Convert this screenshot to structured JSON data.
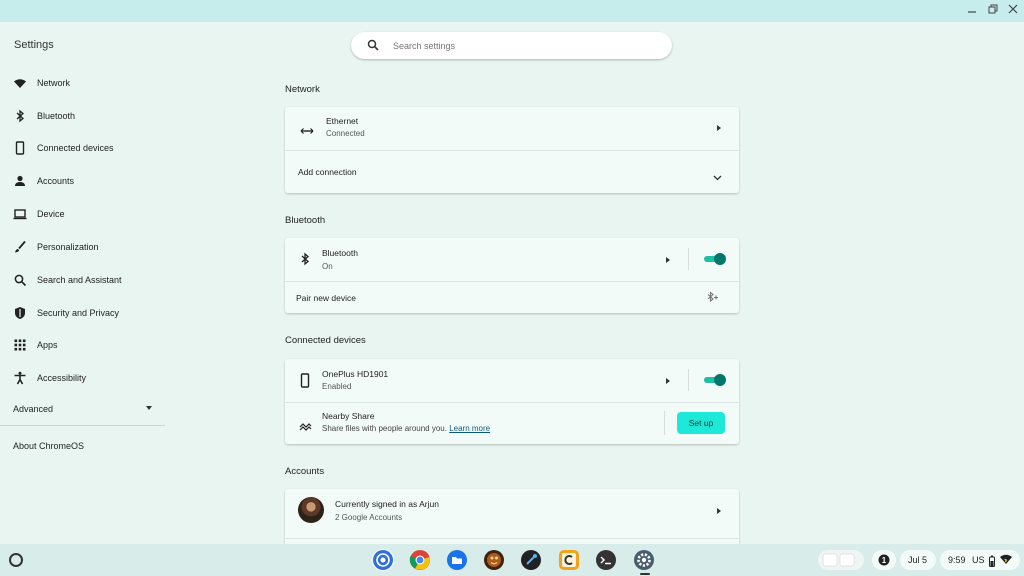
{
  "window": {
    "minimize_icon": "minimize-icon",
    "restore_icon": "restore-icon",
    "close_icon": "close-icon"
  },
  "app": {
    "title": "Settings"
  },
  "search": {
    "placeholder": "Search settings",
    "icon": "search-icon"
  },
  "sidebar": {
    "items": [
      {
        "label": "Network",
        "icon": "wifi-icon"
      },
      {
        "label": "Bluetooth",
        "icon": "bluetooth-icon"
      },
      {
        "label": "Connected devices",
        "icon": "phone-icon"
      },
      {
        "label": "Accounts",
        "icon": "person-icon"
      },
      {
        "label": "Device",
        "icon": "laptop-icon"
      },
      {
        "label": "Personalization",
        "icon": "brush-icon"
      },
      {
        "label": "Search and Assistant",
        "icon": "search-icon"
      },
      {
        "label": "Security and Privacy",
        "icon": "shield-icon"
      },
      {
        "label": "Apps",
        "icon": "apps-grid-icon"
      },
      {
        "label": "Accessibility",
        "icon": "accessibility-icon"
      }
    ],
    "advanced_label": "Advanced",
    "about_label": "About ChromeOS"
  },
  "network": {
    "section_title": "Network",
    "ethernet_label": "Ethernet",
    "ethernet_status": "Connected",
    "add_connection_label": "Add connection"
  },
  "bluetooth": {
    "section_title": "Bluetooth",
    "label": "Bluetooth",
    "status": "On",
    "enabled": true,
    "pair_label": "Pair new device"
  },
  "connected_devices": {
    "section_title": "Connected devices",
    "phone_label": "OnePlus HD1901",
    "phone_status": "Enabled",
    "phone_enabled": true,
    "nearby_label": "Nearby Share",
    "nearby_desc": "Share files with people around you.",
    "nearby_link": "Learn more",
    "setup_label": "Set up"
  },
  "accounts": {
    "section_title": "Accounts",
    "signed_in_label": "Currently signed in as Arjun",
    "accounts_count": "2 Google Accounts"
  },
  "shelf": {
    "apps": [
      {
        "name": "podcast-app-icon",
        "color": "#2f6fd6"
      },
      {
        "name": "chrome-icon",
        "color": "#db4437"
      },
      {
        "name": "files-icon",
        "color": "#1a73e8"
      },
      {
        "name": "game-app-icon",
        "color": "#b05a1c"
      },
      {
        "name": "link-app-icon",
        "color": "#222222"
      },
      {
        "name": "c-app-icon",
        "color": "#f3a21b"
      },
      {
        "name": "terminal-icon",
        "color": "#333333"
      },
      {
        "name": "settings-gear-icon",
        "color": "#4a5d6e"
      }
    ],
    "notification_count": "1",
    "date": "Jul 5",
    "time": "9:59",
    "locale": "US"
  },
  "colors": {
    "accent": "#1fbfa5",
    "toggle_knob": "#00776a",
    "setup_button": "#1ee8d8",
    "background": "#e8f5f0"
  }
}
